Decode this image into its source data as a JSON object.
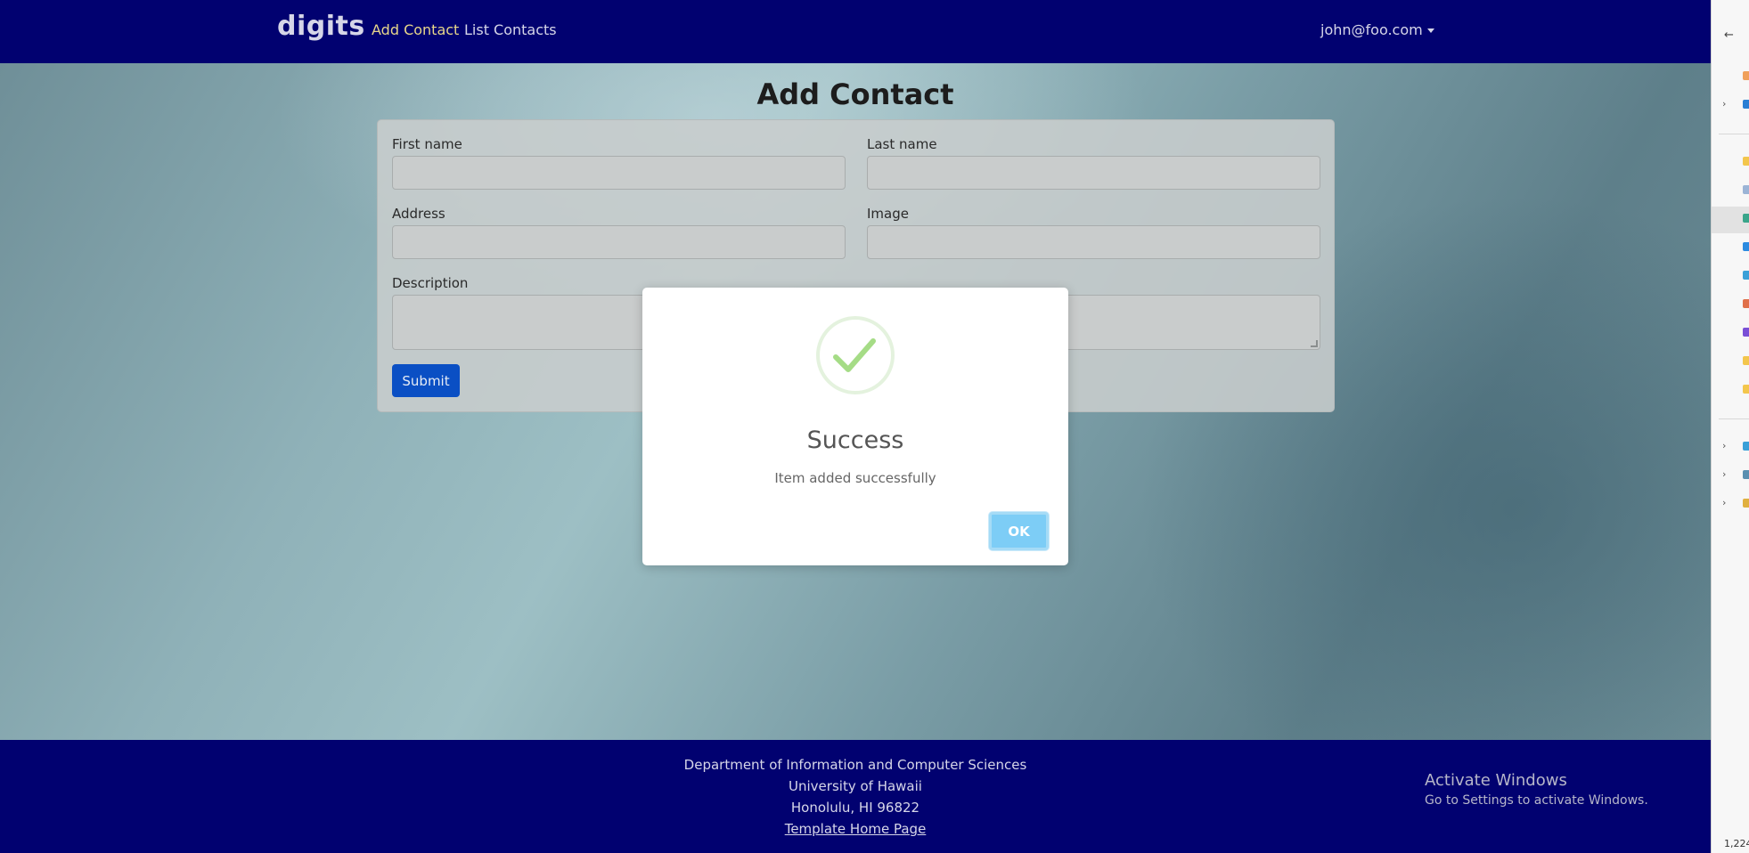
{
  "navbar": {
    "brand": "digits",
    "links": [
      {
        "label": "Add Contact",
        "active": true
      },
      {
        "label": "List Contacts",
        "active": false
      }
    ],
    "user": "john@foo.com"
  },
  "page": {
    "title": "Add Contact"
  },
  "form": {
    "first_name_label": "First name",
    "last_name_label": "Last name",
    "address_label": "Address",
    "image_label": "Image",
    "description_label": "Description",
    "submit_label": "Submit"
  },
  "modal": {
    "icon": "check-icon",
    "title": "Success",
    "text": "Item added successfully",
    "ok_label": "OK"
  },
  "footer": {
    "line1": "Department of Information and Computer Sciences",
    "line2": "University of Hawaii",
    "line3": "Honolulu, HI 96822",
    "link": "Template Home Page"
  },
  "watermark": {
    "title": "Activate Windows",
    "subtitle": "Go to Settings to activate Windows."
  },
  "side_panel": {
    "count_text": "1,224"
  },
  "colors": {
    "navbar": "#010170",
    "submit": "#0a4fc4",
    "ok": "#7dcdf6",
    "success": "#a5dc86"
  }
}
